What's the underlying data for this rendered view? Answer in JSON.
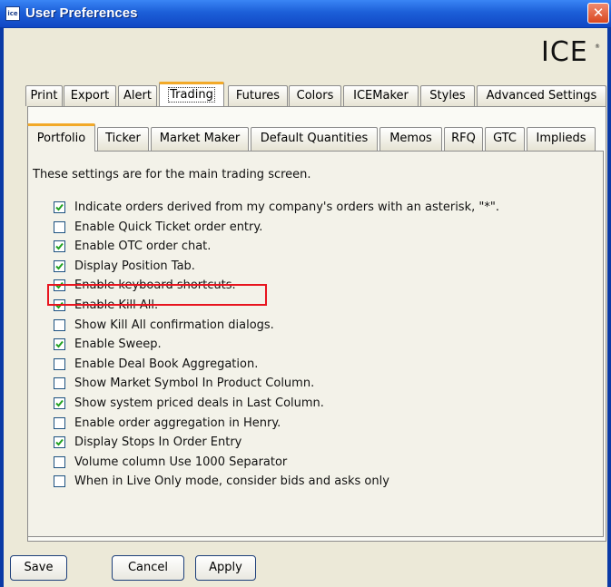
{
  "window": {
    "title": "User Preferences",
    "app_icon_text": "ice",
    "close_glyph": "✕"
  },
  "brand": {
    "logo": "ICE",
    "trademark": "®"
  },
  "main_tabs": [
    {
      "label": "Print",
      "active": false
    },
    {
      "label": "Export",
      "active": false
    },
    {
      "label": "Alert",
      "active": false
    },
    {
      "label": "Trading",
      "active": true
    },
    {
      "label": "Futures",
      "active": false
    },
    {
      "label": "Colors",
      "active": false
    },
    {
      "label": "ICEMaker",
      "active": false
    },
    {
      "label": "Styles",
      "active": false
    },
    {
      "label": "Advanced Settings",
      "active": false
    }
  ],
  "sub_tabs": [
    {
      "label": "Portfolio",
      "active": true
    },
    {
      "label": "Ticker",
      "active": false
    },
    {
      "label": "Market Maker",
      "active": false
    },
    {
      "label": "Default Quantities",
      "active": false
    },
    {
      "label": "Memos",
      "active": false
    },
    {
      "label": "RFQ",
      "active": false
    },
    {
      "label": "GTC",
      "active": false
    },
    {
      "label": "Implieds",
      "active": false
    }
  ],
  "portfolio": {
    "intro": "These settings are for the main trading screen.",
    "options": [
      {
        "label": "Indicate orders derived from my company's orders with an asterisk, \"*\".",
        "checked": true
      },
      {
        "label": "Enable Quick Ticket order entry.",
        "checked": false
      },
      {
        "label": "Enable OTC order chat.",
        "checked": true
      },
      {
        "label": "Display Position Tab.",
        "checked": true
      },
      {
        "label": "Enable keyboard shortcuts.",
        "checked": true
      },
      {
        "label": "Enable Kill All.",
        "checked": true
      },
      {
        "label": "Show Kill All confirmation dialogs.",
        "checked": false
      },
      {
        "label": "Enable Sweep.",
        "checked": true
      },
      {
        "label": "Enable Deal Book Aggregation.",
        "checked": false
      },
      {
        "label": "Show Market Symbol In Product Column.",
        "checked": false
      },
      {
        "label": "Show system priced deals in Last Column.",
        "checked": true
      },
      {
        "label": "Enable order aggregation in Henry.",
        "checked": false
      },
      {
        "label": "Display Stops In Order Entry",
        "checked": true
      },
      {
        "label": "Volume column Use 1000 Separator",
        "checked": false
      },
      {
        "label": "When in Live Only mode, consider bids and asks only",
        "checked": false
      }
    ]
  },
  "buttons": {
    "save": "Save",
    "cancel": "Cancel",
    "apply": "Apply"
  },
  "colors": {
    "titlebar": "#1c5fd8",
    "tab_accent": "#f2a928",
    "highlight": "#e8141e",
    "check": "#21a121"
  }
}
